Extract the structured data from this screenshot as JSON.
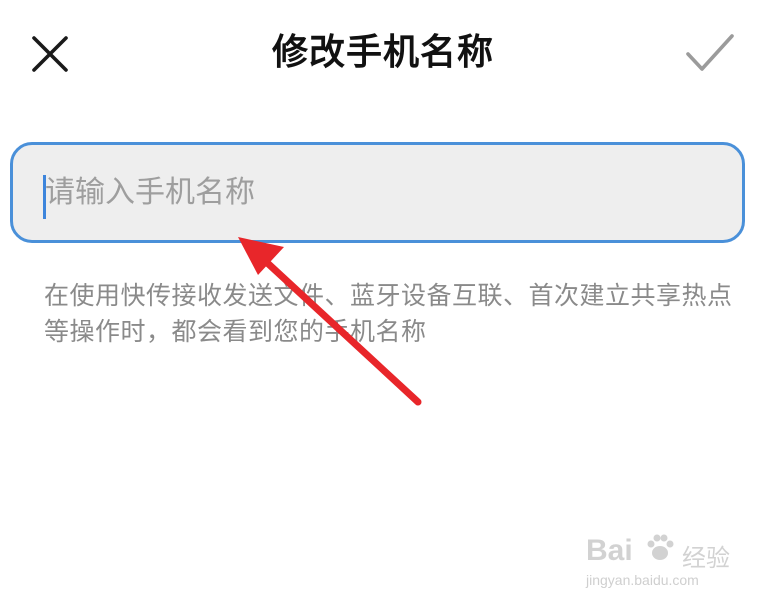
{
  "header": {
    "title": "修改手机名称",
    "close_icon": "close-icon",
    "confirm_icon": "check-icon"
  },
  "name_field": {
    "value": "",
    "placeholder": "请输入手机名称"
  },
  "hint_text": "在使用快传接收发送文件、蓝牙设备互联、首次建立共享热点等操作时，都会看到您的手机名称",
  "annotation": {
    "arrow_color": "#e8262a"
  },
  "watermark": {
    "logo_text": "Bai",
    "cn_text": "经验",
    "url": "jingyan.baidu.com"
  },
  "colors": {
    "accent": "#4a90d9",
    "title": "#111111",
    "hint": "#8a8a8a",
    "input_bg": "#eeeeee"
  }
}
